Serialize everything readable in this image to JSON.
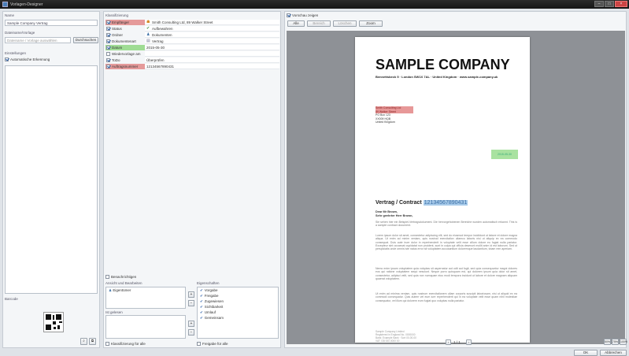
{
  "window": {
    "title": "Vorlagen-Designer",
    "controls": [
      "–",
      "□",
      "×"
    ]
  },
  "left": {
    "name_label": "Name",
    "name_value": "Sample Company Vertrag",
    "file_label": "Dateiname/Vorlage",
    "file_placeholder": "Dateiname / Vorlage auswählen",
    "browse_button": "Durchsuchen",
    "options_label": "Einstellungen",
    "option_checkbox": "Automatische Erkennung",
    "barcode_label": "Barcode"
  },
  "middle": {
    "header": "Klassifizierung",
    "fields": [
      {
        "name": "Empfänger",
        "value": "Smith Consulting Ltd, 89 Walker Street",
        "name_hl": "#e59a9a",
        "checked": true,
        "icon": "contact-icon"
      },
      {
        "name": "Status",
        "value": "Aufbewahren",
        "name_hl": "",
        "checked": true,
        "icon": "status-icon"
      },
      {
        "name": "Ordner",
        "value": "Dokumenten",
        "name_hl": "",
        "checked": true,
        "icon": "folder-icon"
      },
      {
        "name": "Dokumentenart",
        "value": "Vertrag",
        "name_hl": "",
        "checked": true,
        "icon": "document-type-icon"
      },
      {
        "name": "Datum",
        "value": "2015-05-30",
        "name_hl": "#9fdc94",
        "checked": true,
        "icon": ""
      },
      {
        "name": "Wiedervorlage am",
        "value": "",
        "name_hl": "",
        "checked": false,
        "icon": ""
      },
      {
        "name": "ToDo",
        "value": "Überprüfen",
        "name_hl": "",
        "checked": true,
        "icon": ""
      },
      {
        "name": "Auftragsnummer",
        "value": "12134567890431",
        "name_hl": "#e59a9a",
        "checked": true,
        "icon": ""
      }
    ],
    "addl_checkbox": "Benachrichtigen",
    "addl_label": "Ansicht und Bearbeiten",
    "addl_item": "Eigentümer",
    "second_label": "Ist gelesen",
    "properties_header": "Eigenschaften",
    "properties": [
      "Vorgabe",
      "Freigabe",
      "Zugewiesen",
      "Sichtbarkeit",
      "Umlauf",
      "Gemeinsam"
    ],
    "bottom_left_checkbox": "Klassifizierung für alle",
    "bottom_right_checkbox": "Freigabe für alle"
  },
  "right": {
    "preview_checkbox": "Vorschau zeigen",
    "toolbar": [
      "Alle",
      "Bereich",
      "Löschen",
      "Zoom"
    ],
    "page_indicator": "1 / 1",
    "zoom_buttons": [
      "50%",
      "75%",
      "100%"
    ],
    "ok_button": "OK",
    "cancel_button": "Abbrechen"
  },
  "document": {
    "company": "SAMPLE COMPANY",
    "address": "Bennettsbeck 5 · London SW1X 7AL · United Kingdom · www.sample-company.uk",
    "recipient_hl": [
      "Smith Consulting Ltd",
      "89 Walker Street"
    ],
    "recipient": [
      "PO Box 123",
      "XX009 HQB",
      "United Kingdom"
    ],
    "date": "2015-05-30",
    "contract_label": "Vertrag / Contract",
    "contract_number": "12134567890431",
    "greeting": [
      "Dear Mr Brown,",
      "Sehr geehrter Herr Brown,"
    ],
    "intro": "Sie sehen hier ein Beispiel-Vertragsdokument. Die hervorgehobenen Bereiche wurden automatisch erkannt. This is a sample contract document.",
    "p1": "Lorem ipsum dolor sit amet, consectetur adipiscing elit, sed do eiusmod tempor incididunt ut labore et dolore magna aliqua. Ut enim ad minim veniam, quis nostrud exercitation ullamco laboris nisi ut aliquip ex ea commodo consequat. Duis aute irure dolor in reprehenderit in voluptate velit esse cillum dolore eu fugiat nulla pariatur. Excepteur sint occaecat cupidatat non proident, sunt in culpa qui officia deserunt mollit anim id est laborum. Sed ut perspiciatis unde omnis iste natus error sit voluptatem accusantium doloremque laudantium, totam rem aperiam.",
    "p2": "Nemo enim ipsam voluptatem quia voluptas sit aspernatur aut odit aut fugit, sed quia consequuntur magni dolores eos qui ratione voluptatem sequi nesciunt. Neque porro quisquam est, qui dolorem ipsum quia dolor sit amet, consectetur, adipisci velit, sed quia non numquam eius modi tempora incidunt ut labore et dolore magnam aliquam quaerat voluptatem.",
    "p3": "Ut enim ad minima veniam, quis nostrum exercitationem ullam corporis suscipit laboriosam, nisi ut aliquid ex ea commodi consequatur. Quis autem vel eum iure reprehenderit qui in ea voluptate velit esse quam nihil molestiae consequatur, vel illum qui dolorem eum fugiat quo voluptas nulla pariatur.",
    "footer": [
      "Sample Company Limited",
      "Registered in England No. 0000000",
      "Bank: Example Bank · Sort 00-00-00",
      "VAT: GB 000 0000 00"
    ]
  }
}
